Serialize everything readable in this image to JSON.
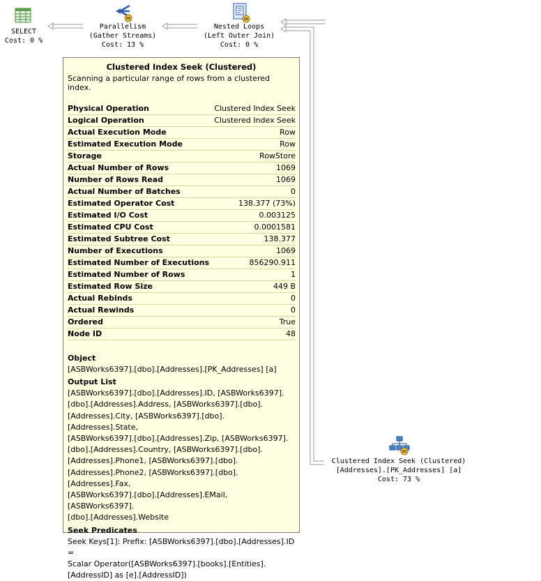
{
  "plan": {
    "select": {
      "name": "SELECT",
      "cost": "Cost: 0 %"
    },
    "parallelism": {
      "name": "Parallelism",
      "sub": "(Gather Streams)",
      "cost": "Cost: 13 %"
    },
    "nested_loops": {
      "name": "Nested Loops",
      "sub": "(Left Outer Join)",
      "cost": "Cost: 0 %"
    },
    "seek": {
      "name": "Clustered Index Seek (Clustered)",
      "sub": "[Addresses].[PK_Addresses] [a]",
      "cost": "Cost: 73 %"
    }
  },
  "tooltip": {
    "title": "Clustered Index Seek (Clustered)",
    "description": "Scanning a particular range of rows from a clustered index.",
    "properties": [
      {
        "k": "Physical Operation",
        "v": "Clustered Index Seek"
      },
      {
        "k": "Logical Operation",
        "v": "Clustered Index Seek"
      },
      {
        "k": "Actual Execution Mode",
        "v": "Row"
      },
      {
        "k": "Estimated Execution Mode",
        "v": "Row"
      },
      {
        "k": "Storage",
        "v": "RowStore"
      },
      {
        "k": "Actual Number of Rows",
        "v": "1069"
      },
      {
        "k": "Number of Rows Read",
        "v": "1069"
      },
      {
        "k": "Actual Number of Batches",
        "v": "0"
      },
      {
        "k": "Estimated Operator Cost",
        "v": "138.377 (73%)"
      },
      {
        "k": "Estimated I/O Cost",
        "v": "0.003125"
      },
      {
        "k": "Estimated CPU Cost",
        "v": "0.0001581"
      },
      {
        "k": "Estimated Subtree Cost",
        "v": "138.377"
      },
      {
        "k": "Number of Executions",
        "v": "1069"
      },
      {
        "k": "Estimated Number of Executions",
        "v": "856290.911"
      },
      {
        "k": "Estimated Number of Rows",
        "v": "1"
      },
      {
        "k": "Estimated Row Size",
        "v": "449 B"
      },
      {
        "k": "Actual Rebinds",
        "v": "0"
      },
      {
        "k": "Actual Rewinds",
        "v": "0"
      },
      {
        "k": "Ordered",
        "v": "True"
      },
      {
        "k": "Node ID",
        "v": "48"
      }
    ],
    "object_heading": "Object",
    "object_value": "[ASBWorks6397].[dbo].[Addresses].[PK_Addresses] [a]",
    "output_heading": "Output List",
    "output_lines": [
      "[ASBWorks6397].[dbo].[Addresses].ID, [ASBWorks6397].",
      "[dbo].[Addresses].Address, [ASBWorks6397].[dbo].",
      "[Addresses].City, [ASBWorks6397].[dbo].[Addresses].State,",
      "[ASBWorks6397].[dbo].[Addresses].Zip, [ASBWorks6397].",
      "[dbo].[Addresses].Country, [ASBWorks6397].[dbo].",
      "[Addresses].Phone1, [ASBWorks6397].[dbo].",
      "[Addresses].Phone2, [ASBWorks6397].[dbo].[Addresses].Fax,",
      "[ASBWorks6397].[dbo].[Addresses].EMail, [ASBWorks6397].",
      "[dbo].[Addresses].Website"
    ],
    "seek_heading": "Seek Predicates",
    "seek_lines": [
      "Seek Keys[1]: Prefix: [ASBWorks6397].[dbo].[Addresses].ID =",
      "Scalar Operator([ASBWorks6397].[books].[Entities].",
      "[AddressID] as [e].[AddressID])"
    ]
  }
}
